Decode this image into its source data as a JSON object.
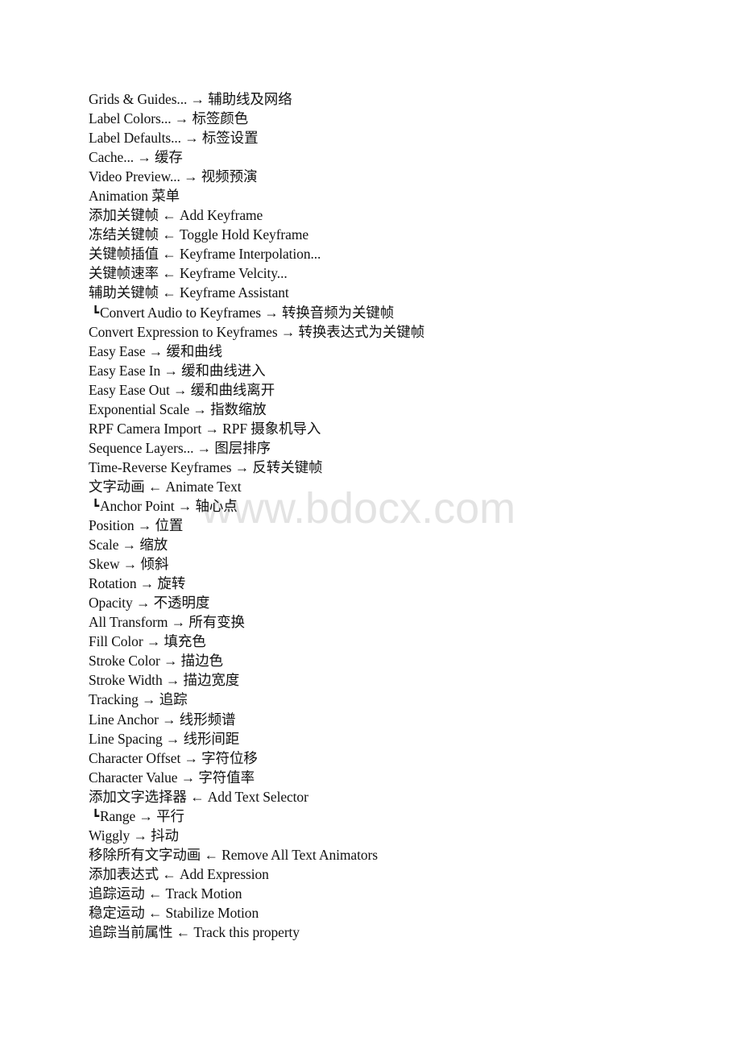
{
  "watermark": "www.bdocx.com",
  "lines": [
    {
      "text": "Grids & Guides... → 辅助线及网络",
      "sub": false
    },
    {
      "text": "Label Colors... → 标签颜色",
      "sub": false
    },
    {
      "text": "Label Defaults... → 标签设置",
      "sub": false
    },
    {
      "text": "Cache... → 缓存",
      "sub": false
    },
    {
      "text": "Video Preview... → 视频预演",
      "sub": false
    },
    {
      "text": "Animation 菜单",
      "sub": false
    },
    {
      "text": "添加关键帧 ← Add Keyframe",
      "sub": false
    },
    {
      "text": "冻结关键帧 ← Toggle Hold Keyframe",
      "sub": false
    },
    {
      "text": "关键帧插值 ← Keyframe Interpolation...",
      "sub": false
    },
    {
      "text": "关键帧速率 ← Keyframe Velcity...",
      "sub": false
    },
    {
      "text": "辅助关键帧 ← Keyframe Assistant",
      "sub": false
    },
    {
      "text": "Convert Audio to Keyframes → 转换音频为关键帧",
      "sub": true
    },
    {
      "text": "Convert Expression to Keyframes → 转换表达式为关键帧",
      "sub": false
    },
    {
      "text": "Easy Ease → 缓和曲线",
      "sub": false
    },
    {
      "text": "Easy Ease In → 缓和曲线进入",
      "sub": false
    },
    {
      "text": "Easy Ease Out → 缓和曲线离开",
      "sub": false
    },
    {
      "text": "Exponential Scale → 指数缩放",
      "sub": false
    },
    {
      "text": "RPF Camera Import → RPF 摄象机导入",
      "sub": false
    },
    {
      "text": "Sequence Layers... → 图层排序",
      "sub": false
    },
    {
      "text": "Time-Reverse Keyframes → 反转关键帧",
      "sub": false
    },
    {
      "text": "文字动画 ← Animate Text",
      "sub": false
    },
    {
      "text": "Anchor Point → 轴心点",
      "sub": true
    },
    {
      "text": "Position → 位置",
      "sub": false
    },
    {
      "text": "Scale → 缩放",
      "sub": false
    },
    {
      "text": "Skew → 倾斜",
      "sub": false
    },
    {
      "text": "Rotation → 旋转",
      "sub": false
    },
    {
      "text": "Opacity → 不透明度",
      "sub": false
    },
    {
      "text": "All Transform → 所有变换",
      "sub": false
    },
    {
      "text": "Fill Color → 填充色",
      "sub": false
    },
    {
      "text": "Stroke Color → 描边色",
      "sub": false
    },
    {
      "text": "Stroke Width → 描边宽度",
      "sub": false
    },
    {
      "text": "Tracking → 追踪",
      "sub": false
    },
    {
      "text": "Line Anchor → 线形频谱",
      "sub": false
    },
    {
      "text": "Line Spacing → 线形间距",
      "sub": false
    },
    {
      "text": "Character Offset → 字符位移",
      "sub": false
    },
    {
      "text": "Character Value → 字符值率",
      "sub": false
    },
    {
      "text": "添加文字选择器 ← Add Text Selector",
      "sub": false
    },
    {
      "text": "Range → 平行",
      "sub": true
    },
    {
      "text": "Wiggly → 抖动",
      "sub": false
    },
    {
      "text": "移除所有文字动画 ← Remove All Text Animators",
      "sub": false
    },
    {
      "text": "添加表达式 ← Add Expression",
      "sub": false
    },
    {
      "text": "追踪运动 ← Track Motion",
      "sub": false
    },
    {
      "text": "稳定运动 ← Stabilize Motion",
      "sub": false
    },
    {
      "text": "追踪当前属性 ← Track this property",
      "sub": false
    }
  ],
  "sub_marker": "┗"
}
